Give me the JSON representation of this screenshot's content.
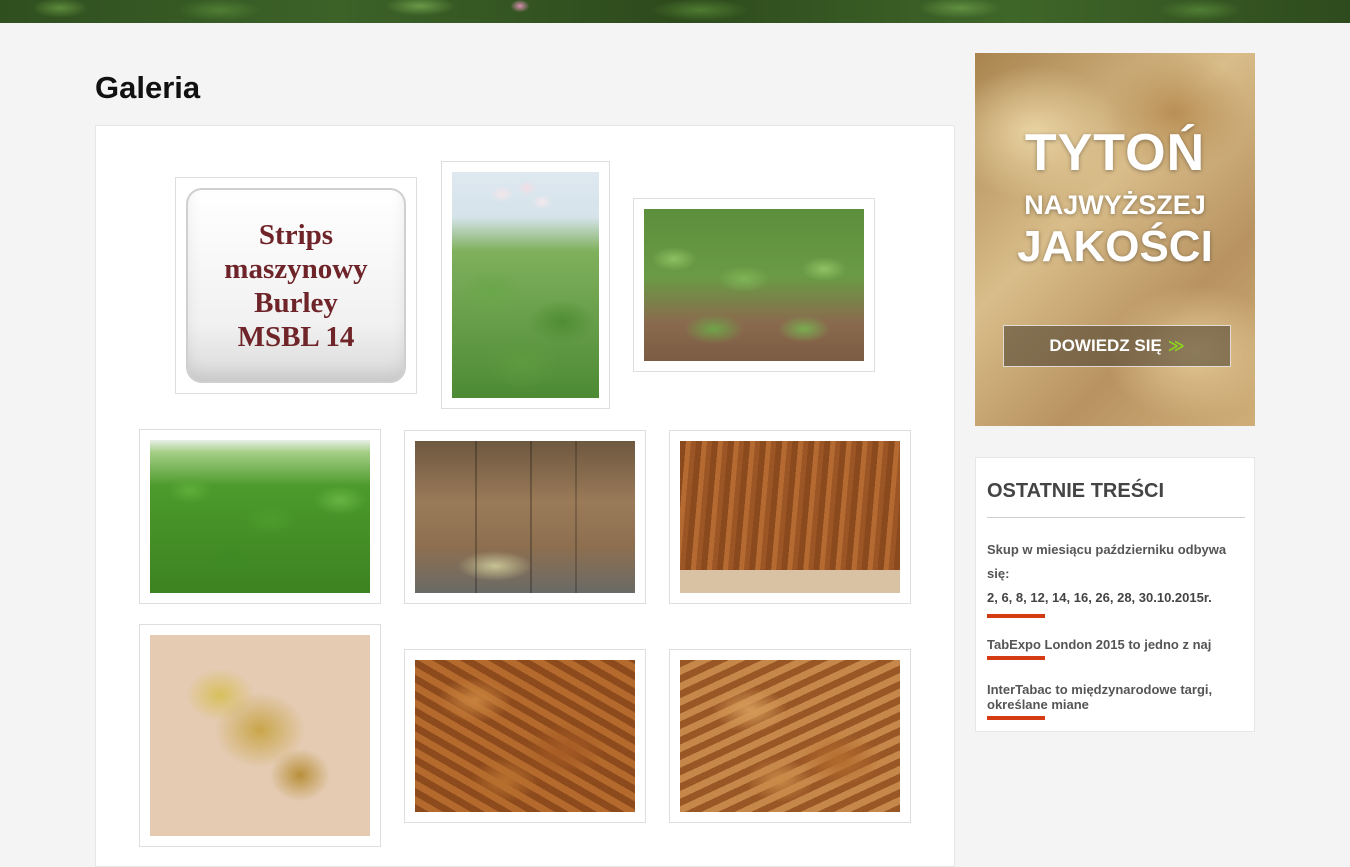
{
  "page": {
    "title": "Galeria"
  },
  "gallery": {
    "items": [
      {
        "name": "strips-maszynowy-burley-image",
        "caption_lines": [
          "Strips",
          "maszynowy",
          "Burley",
          "MSBL 14"
        ]
      },
      {
        "name": "tobacco-flower-image"
      },
      {
        "name": "tobacco-field-rows-image"
      },
      {
        "name": "tobacco-field-green-image"
      },
      {
        "name": "tobacco-boxes-warehouse-image"
      },
      {
        "name": "tobacco-hanging-leaves-image"
      },
      {
        "name": "yellow-dried-leaves-image"
      },
      {
        "name": "brown-dried-leaves-image"
      },
      {
        "name": "brown-cured-leaves-image"
      }
    ]
  },
  "sidebar": {
    "banner": {
      "line1": "TYTOŃ",
      "line2": "NAJWYŻSZEJ",
      "line3": "JAKOŚCI",
      "button_label": "DOWIEDZ SIĘ",
      "button_arrow": "≫"
    },
    "recent": {
      "title": "OSTATNIE TREŚCI",
      "items": [
        {
          "text": "Skup w miesiącu październiku odbywa się:",
          "date_line": "2, 6, 8, 12, 14, 16, 26, 28, 30.10.2015r."
        },
        {
          "text": "TabExpo London 2015 to jedno z naj"
        },
        {
          "text": "InterTabac to międzynarodowe targi, określane miane"
        }
      ]
    }
  },
  "colors": {
    "accent_bar": "#d43b12",
    "banner_arrow": "#8bd31c",
    "strips_text": "#6e2428"
  }
}
